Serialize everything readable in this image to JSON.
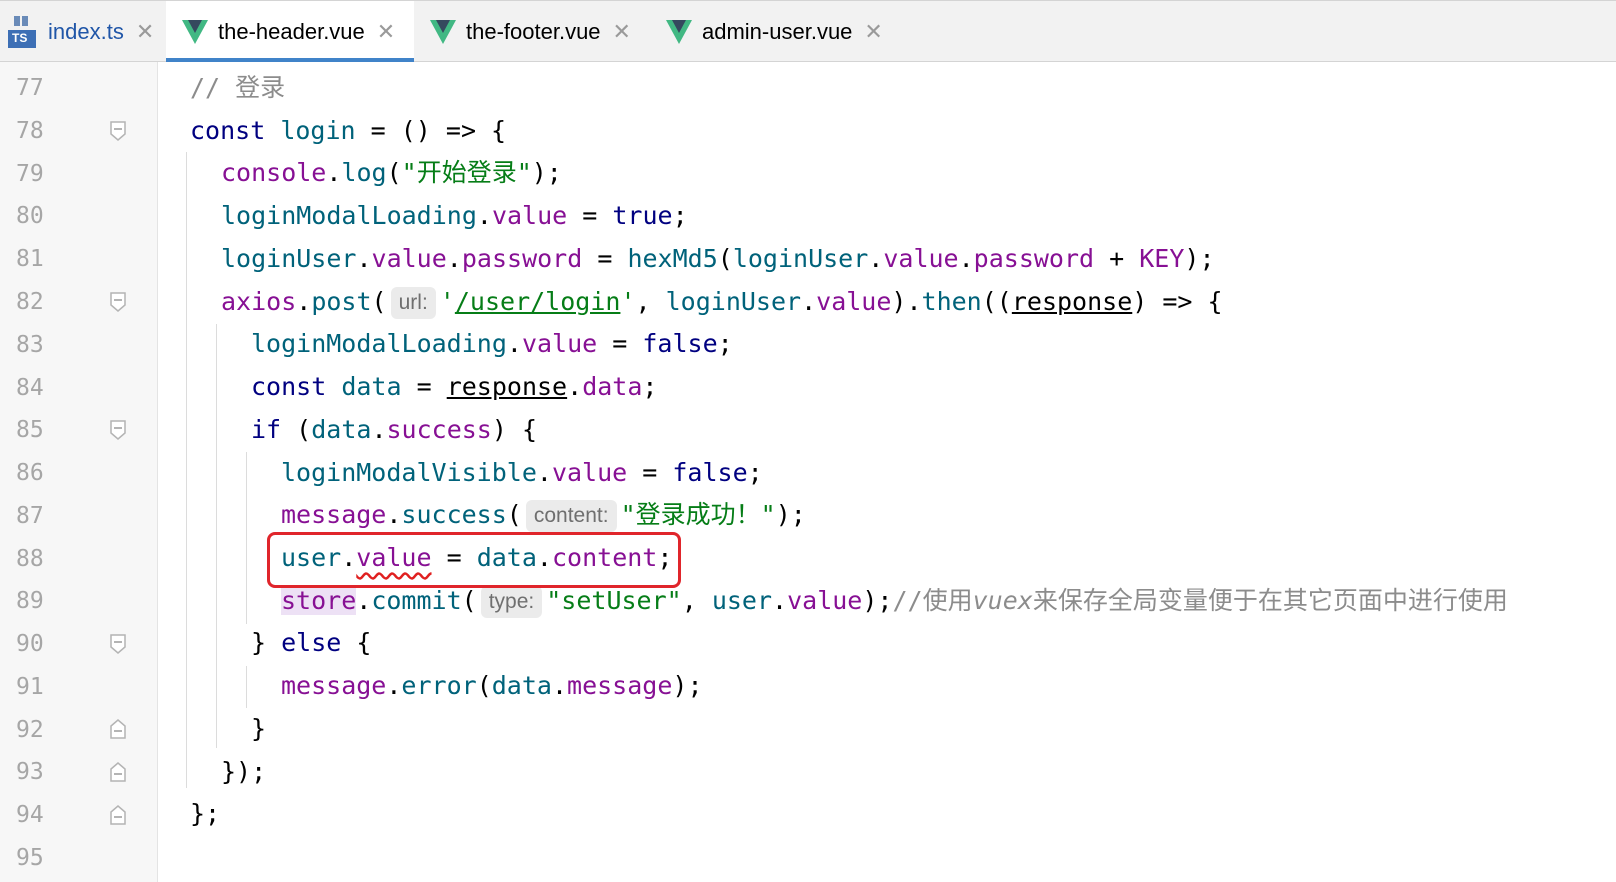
{
  "tabs": [
    {
      "label": "index.ts",
      "icon": "typescript-file-icon",
      "active": false
    },
    {
      "label": "the-header.vue",
      "icon": "vue-file-icon",
      "active": true
    },
    {
      "label": "the-footer.vue",
      "icon": "vue-file-icon",
      "active": false
    },
    {
      "label": "admin-user.vue",
      "icon": "vue-file-icon",
      "active": false
    }
  ],
  "close_glyph": "✕",
  "ts_badge": "TS",
  "colors": {
    "keyword": "#000080",
    "property": "#871094",
    "function": "#00627a",
    "string": "#067d17",
    "comment": "#8c8c8c",
    "highlight_box": "#e0252b",
    "active_tab_underline": "#4083c9",
    "vue_green": "#41b883"
  },
  "line_numbers": [
    "77",
    "78",
    "79",
    "80",
    "81",
    "82",
    "83",
    "84",
    "85",
    "86",
    "87",
    "88",
    "89",
    "90",
    "91",
    "92",
    "93",
    "94",
    "95"
  ],
  "code": {
    "l77": {
      "comment": "// 登录"
    },
    "l78": {
      "kw_const": "const",
      "name": "login",
      "rest": " = () => {"
    },
    "l79": {
      "obj": "console",
      "fn": "log",
      "str": "\"开始登录\"",
      "end": ");"
    },
    "l80": {
      "obj": "loginModalLoading",
      "prop": "value",
      "eq": " = ",
      "kw": "true",
      "end": ";"
    },
    "l81": {
      "obj": "loginUser",
      "p1": "value",
      "p2": "password",
      "eq": " = ",
      "fn": "hexMd5",
      "obj2": "loginUser",
      "p3": "value",
      "p4": "password",
      "plus": " + ",
      "key": "KEY",
      "end": ");"
    },
    "l82": {
      "obj": "axios",
      "fn": "post",
      "hint": "url:",
      "str_q1": "'",
      "path": "/user/login",
      "str_q2": "'",
      "comma": ", ",
      "obj2": "loginUser",
      "p1": "value",
      "then": "then",
      "param": "response",
      "rest": ") => {"
    },
    "l83": {
      "obj": "loginModalLoading",
      "prop": "value",
      "eq": " = ",
      "kw": "false",
      "end": ";"
    },
    "l84": {
      "kw_const": "const",
      "name": "data",
      "eq": " = ",
      "obj": "response",
      "prop": "data",
      "end": ";"
    },
    "l85": {
      "kw_if": "if",
      "obj": "data",
      "prop": "success",
      "rest": ") {"
    },
    "l86": {
      "obj": "loginModalVisible",
      "prop": "value",
      "eq": " = ",
      "kw": "false",
      "end": ";"
    },
    "l87": {
      "obj": "message",
      "fn": "success",
      "hint": "content:",
      "str": "\"登录成功！\"",
      "end": ");"
    },
    "l88": {
      "obj": "user",
      "prop": "value",
      "eq": " = ",
      "obj2": "data",
      "prop2": "content",
      "end": ";"
    },
    "l89": {
      "obj": "store",
      "fn": "commit",
      "hint": "type:",
      "str": "\"setUser\"",
      "comma": ", ",
      "obj2": "user",
      "prop": "value",
      "end": ");",
      "comment_slash": "//",
      "comment_text": "使用",
      "comment_it": "vuex",
      "comment_rest": "来保存全局变量便于在其它页面中进行使用"
    },
    "l90": {
      "brace": "} ",
      "kw_else": "else",
      "rest": " {"
    },
    "l91": {
      "obj": "message",
      "fn": "error",
      "obj2": "data",
      "prop": "message",
      "end": ");"
    },
    "l92": {
      "brace": "}"
    },
    "l93": {
      "brace": "});"
    },
    "l94": {
      "brace": "};"
    }
  }
}
